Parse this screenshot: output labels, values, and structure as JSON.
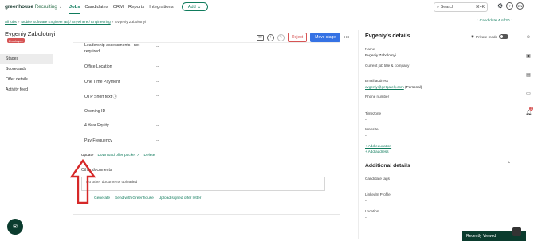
{
  "brand": {
    "logo_main": "greenhouse",
    "logo_sub": "Recruiting",
    "chevron": "⌄"
  },
  "nav": {
    "items": [
      "Jobs",
      "Candidates",
      "CRM",
      "Reports",
      "Integrations"
    ],
    "add_label": "Add"
  },
  "search": {
    "placeholder": "Search",
    "shortcut": "⌘+K"
  },
  "account": {
    "initials": "EN"
  },
  "breadcrumb": {
    "all_jobs": "All jobs",
    "job": "Mobile Software Engineer (B) / Anywhere / Engineering",
    "current": "Evgeniy Zabolotnyi"
  },
  "candidate_nav": {
    "label": "Candidate 4 of 30"
  },
  "candidate": {
    "name": "Evgeniy Zabolotnyi",
    "badge": "Employee"
  },
  "left_nav": [
    "Stages",
    "Scorecards",
    "Offer details",
    "Activity feed"
  ],
  "actions": {
    "reject": "Reject",
    "move": "Move stage",
    "more": "•••"
  },
  "offer_fields": [
    {
      "label": "Leadership assessments - not",
      "label2": "required",
      "value": "--"
    },
    {
      "label": "Office Location",
      "value": "--"
    },
    {
      "label": "One Time Payment",
      "value": "--"
    },
    {
      "label": "OTP Short text",
      "value": "--"
    },
    {
      "label": "Opening ID",
      "value": "--"
    },
    {
      "label": "4 Year Equity",
      "value": "--"
    },
    {
      "label": "Pay Frequency",
      "value": "--"
    }
  ],
  "offer_links": {
    "update": "Update",
    "download": "Download offer packet",
    "delete": "Delete"
  },
  "other_documents": {
    "title": "Other documents",
    "empty": "No other documents uploaded"
  },
  "doc_links": {
    "generate": "Generate",
    "send": "Send with Greenhouse",
    "upload": "Upload signed offer letter"
  },
  "details": {
    "title": "Evgeniy's details",
    "private_mode": "Private mode",
    "name_label": "Name",
    "name_value": "Evgeniy Zabolotnyi",
    "job_label": "Current job title & company",
    "job_value": "--",
    "email_label": "Email address",
    "email_value": "evgeniy@getgately.com",
    "email_type": "(Personal)",
    "phone_label": "Phone number",
    "phone_value": "--",
    "tz_label": "Timezone",
    "tz_value": "--",
    "web_label": "Website",
    "web_value": "--",
    "add_education": "+ Add education",
    "add_address": "+ Add address",
    "additional_title": "Additional details",
    "tags_label": "Candidate tags",
    "tags_value": "--",
    "linkedin_label": "LinkedIn Profile",
    "linkedin_value": "--",
    "location_label": "Location",
    "location_value": "--"
  },
  "sidebar_badge": "2",
  "recently_viewed": "Recently Viewed",
  "colors": {
    "accent": "#0f7b5c",
    "primary_button": "#3572e4",
    "reject": "#d65454",
    "dark": "#0b3c2e",
    "annotation_arrow": "#d62828"
  }
}
